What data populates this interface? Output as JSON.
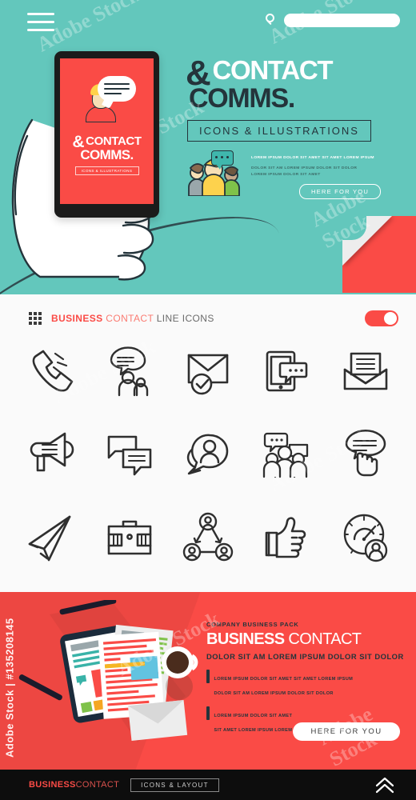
{
  "hero": {
    "menu_icon": "hamburger-icon",
    "search": {
      "icon": "search-icon",
      "value": "",
      "placeholder": ""
    },
    "title_line1": "CONTACT",
    "title_amp": "&",
    "title_line2": "COMMS.",
    "subtitle": "ICONS & ILLUSTRATIONS",
    "copy": {
      "line1": "LOREM IPSUM DOLOR SIT AMET  SIT AMET LOREM IPSUM",
      "line2": "DOLOR SIT AM LOREM IPSUM DOLOR SIT DOLOR",
      "line3": "LOREM IPSUM DOLOR SIT AMET"
    },
    "cta_label": "HERE FOR YOU",
    "colors": {
      "background": "#63c7bc",
      "accent": "#fa4b46",
      "dark": "#24343b"
    }
  },
  "phone": {
    "title_amp": "&",
    "title_line1": "CONTACT",
    "title_line2": "COMMS.",
    "subtitle": "ICONS & ILLUSTRATIONS",
    "screen_color": "#fa4b46"
  },
  "icons_section": {
    "grid_icon": "grid-dots-icon",
    "heading": {
      "bold": "BUSINESS",
      "mid": "CONTACT",
      "light": "LINE ICONS"
    },
    "toggle": {
      "name": "toggle-switch",
      "state": "on",
      "color": "#fa4b46"
    },
    "icons": [
      {
        "name": "phone-ringing-icon",
        "label": "Phone ringing"
      },
      {
        "name": "chat-people-icon",
        "label": "Chat with people"
      },
      {
        "name": "envelope-check-icon",
        "label": "Verified mail"
      },
      {
        "name": "tablet-chat-icon",
        "label": "Tablet message"
      },
      {
        "name": "open-envelope-icon",
        "label": "Open letter"
      },
      {
        "name": "megaphone-icon",
        "label": "Megaphone"
      },
      {
        "name": "chat-bubbles-icon",
        "label": "Chat bubbles"
      },
      {
        "name": "person-bubble-icon",
        "label": "Person in bubble"
      },
      {
        "name": "group-chat-icon",
        "label": "Group chat"
      },
      {
        "name": "hand-bubble-icon",
        "label": "Hand pointing bubble"
      },
      {
        "name": "paper-plane-icon",
        "label": "Paper plane"
      },
      {
        "name": "briefcase-icon",
        "label": "Briefcase"
      },
      {
        "name": "network-people-icon",
        "label": "People network"
      },
      {
        "name": "thumbs-up-icon",
        "label": "Thumbs up"
      },
      {
        "name": "gauge-person-icon",
        "label": "Performance gauge"
      }
    ]
  },
  "red_banner": {
    "kicker": "COMPANY BUSINESS PACK",
    "title_bold": "BUSINESS",
    "title_light": "CONTACT",
    "subtitle": "DOLOR SIT AM LOREM IPSUM DOLOR SIT DOLOR",
    "bullets": [
      {
        "line1": "LOREM IPSUM DOLOR SIT AMET  SIT AMET LOREM IPSUM",
        "line2": "DOLOR SIT AM LOREM IPSUM DOLOR SIT DOLOR"
      },
      {
        "line1": "LOREM IPSUM DOLOR SIT AMET",
        "line2": "SIT AMET LOREM IPSUM LOREM IPSUM DOLOR SIT AMET"
      }
    ],
    "cta_label": "HERE FOR YOU",
    "background": "#fa4b46"
  },
  "footer": {
    "brand_bold": "BUSINESS",
    "brand_light": "CONTACT",
    "tag": "ICONS & LAYOUT",
    "up_icon": "chevron-double-up-icon",
    "background": "#0d0d0d"
  },
  "watermark": {
    "side": "Adobe Stock | #135208145",
    "tiles": [
      "Adobe Stock",
      "Adobe Stock",
      "Adobe Stock",
      "Adobe Stock",
      "Adobe Stock",
      "Adobe Stock",
      "Adobe Stock",
      "Adobe Stock"
    ]
  }
}
